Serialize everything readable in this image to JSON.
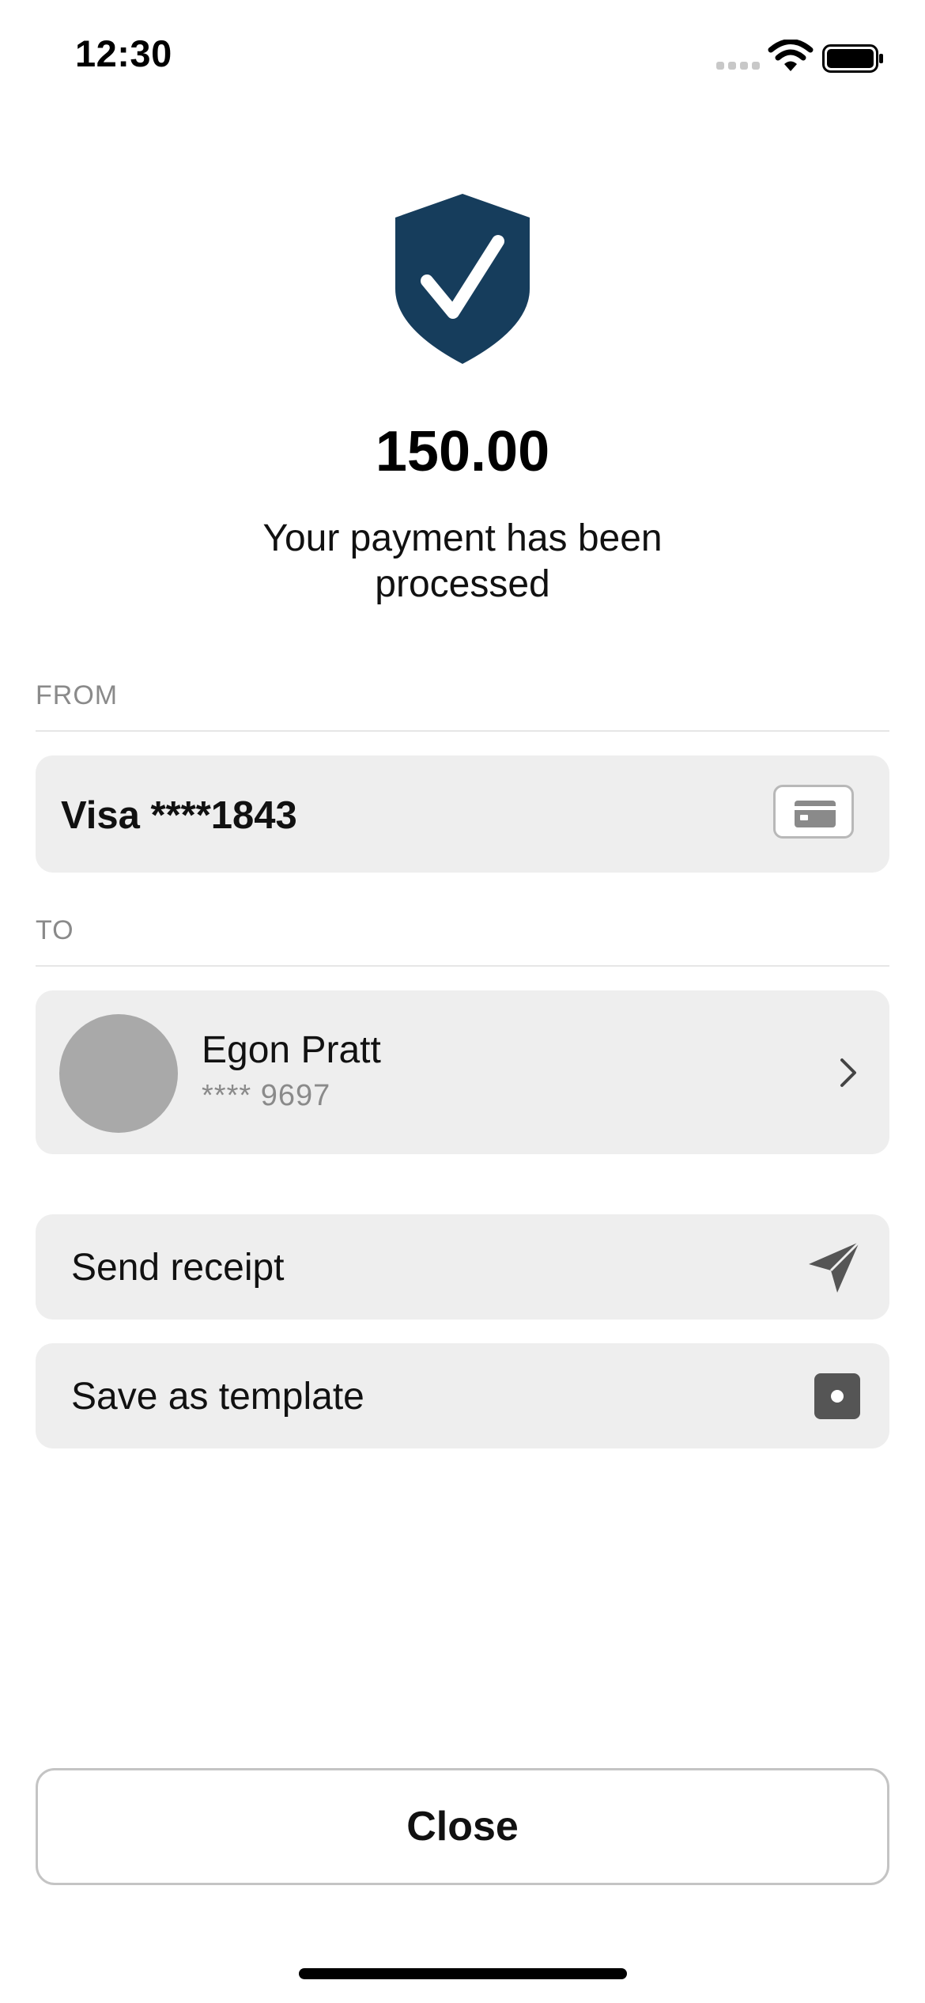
{
  "status_bar": {
    "time": "12:30",
    "icons": [
      "signal-icon",
      "wifi-icon",
      "battery-icon"
    ]
  },
  "header": {
    "icon": "shield-check-icon",
    "icon_color": "#163d5c",
    "amount": "150.00",
    "message": "Your payment has been processed"
  },
  "from": {
    "label": "FROM",
    "card_label": "Visa ****1843",
    "icon": "credit-card-icon"
  },
  "to": {
    "label": "TO",
    "payee_name": "Egon Pratt",
    "payee_account": "**** 9697",
    "icon": "chevron-right-icon"
  },
  "actions": [
    {
      "label": "Send receipt",
      "icon": "paper-plane-icon"
    },
    {
      "label": "Save as template",
      "icon": "template-icon"
    }
  ],
  "footer": {
    "close_label": "Close"
  }
}
